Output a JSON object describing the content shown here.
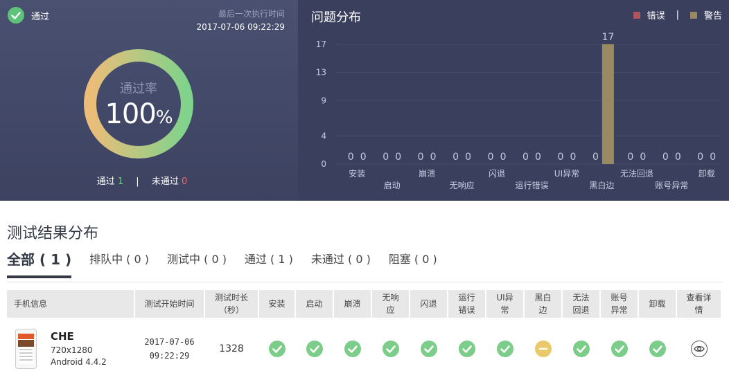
{
  "summary": {
    "status_text": "通过",
    "last_run_label": "最后一次执行时间",
    "last_run_time": "2017-07-06 09:22:29",
    "pass_rate_label": "通过率",
    "pass_rate_value": "100",
    "pass_rate_unit": "%",
    "pass_label": "通过",
    "pass_count": "1",
    "fail_label": "未通过",
    "fail_count": "0",
    "pass_rate_fraction": 1.0,
    "colors": {
      "ring_start": "#ecbd78",
      "ring_end": "#7fd38c",
      "pass_green": "#6fd08a",
      "fail_red": "#f06a6a"
    }
  },
  "chart_data": {
    "type": "bar",
    "title": "问题分布",
    "categories": [
      "安装",
      "启动",
      "崩溃",
      "无响应",
      "闪退",
      "运行错误",
      "UI异常",
      "黑白边",
      "无法回退",
      "账号异常",
      "卸载"
    ],
    "series": [
      {
        "name": "错误",
        "color": "#b0555f",
        "values": [
          0,
          0,
          0,
          0,
          0,
          0,
          0,
          0,
          0,
          0,
          0
        ]
      },
      {
        "name": "警告",
        "color": "#9a8a62",
        "values": [
          0,
          0,
          0,
          0,
          0,
          0,
          0,
          17,
          0,
          0,
          0
        ]
      }
    ],
    "yticks": [
      0,
      4,
      9,
      13,
      17
    ],
    "ylim": [
      0,
      17
    ],
    "legend": "top-right",
    "grid": true
  },
  "results": {
    "title": "测试结果分布",
    "tabs": [
      {
        "label": "全部 ( 1 )"
      },
      {
        "label": "排队中 ( 0 )"
      },
      {
        "label": "测试中 ( 0 )"
      },
      {
        "label": "通过 ( 1 )"
      },
      {
        "label": "未通过 ( 0 )"
      },
      {
        "label": "阻塞 ( 0 )"
      }
    ],
    "headers": {
      "device": "手机信息",
      "start": "测试开始时间",
      "duration": [
        "测试时长",
        "（秒）"
      ],
      "install": "安装",
      "launch": "启动",
      "crash": "崩溃",
      "anr": [
        "无响",
        "应"
      ],
      "flash": "闪退",
      "runtime": [
        "运行",
        "错误"
      ],
      "ui": [
        "UI异",
        "常"
      ],
      "border": [
        "黑白",
        "边"
      ],
      "back": [
        "无法",
        "回退"
      ],
      "account": [
        "账号",
        "异常"
      ],
      "uninstall": "卸载",
      "detail": [
        "查看详",
        "情"
      ]
    },
    "rows": [
      {
        "device_name": "CHE",
        "resolution": "720x1280",
        "os": "Android 4.4.2",
        "start_date": "2017-07-06",
        "start_time": "09:22:29",
        "duration": "1328",
        "checks": [
          "pass",
          "pass",
          "pass",
          "pass",
          "pass",
          "pass",
          "pass",
          "warn",
          "pass",
          "pass",
          "pass"
        ]
      }
    ]
  }
}
